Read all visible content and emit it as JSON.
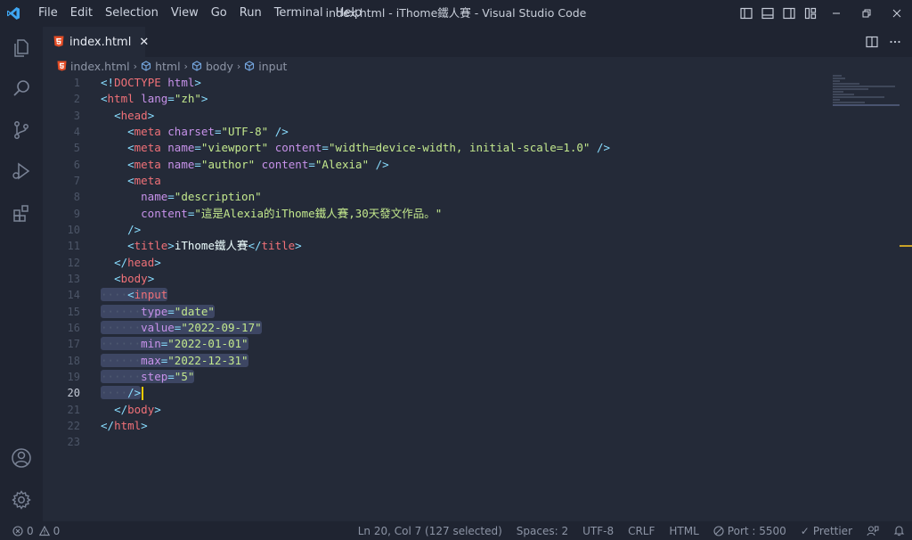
{
  "window": {
    "title": "index.html - iThome鐵人賽 - Visual Studio Code"
  },
  "menu": [
    "File",
    "Edit",
    "Selection",
    "View",
    "Go",
    "Run",
    "Terminal",
    "Help"
  ],
  "tab": {
    "label": "index.html",
    "close": "✕"
  },
  "breadcrumb": [
    "index.html",
    "html",
    "body",
    "input"
  ],
  "editor": {
    "active_line": 20,
    "line_numbers": [
      "1",
      "2",
      "3",
      "4",
      "5",
      "6",
      "7",
      "8",
      "9",
      "10",
      "11",
      "12",
      "13",
      "14",
      "15",
      "16",
      "17",
      "18",
      "19",
      "20",
      "21",
      "22",
      "23"
    ]
  },
  "statusbar": {
    "errors": "0",
    "warnings": "0",
    "position": "Ln 20, Col 7 (127 selected)",
    "spaces": "Spaces: 2",
    "encoding": "UTF-8",
    "eol": "CRLF",
    "language": "HTML",
    "port": "Port : 5500",
    "prettier": "Prettier"
  },
  "colors": {
    "background": "#242a38",
    "chrome": "#1f2431",
    "selection": "#3d4663",
    "tag": "#f07178",
    "attribute": "#c792ea",
    "string": "#c3e88d",
    "punctuation": "#89ddff",
    "cursor": "#ffcc00"
  }
}
